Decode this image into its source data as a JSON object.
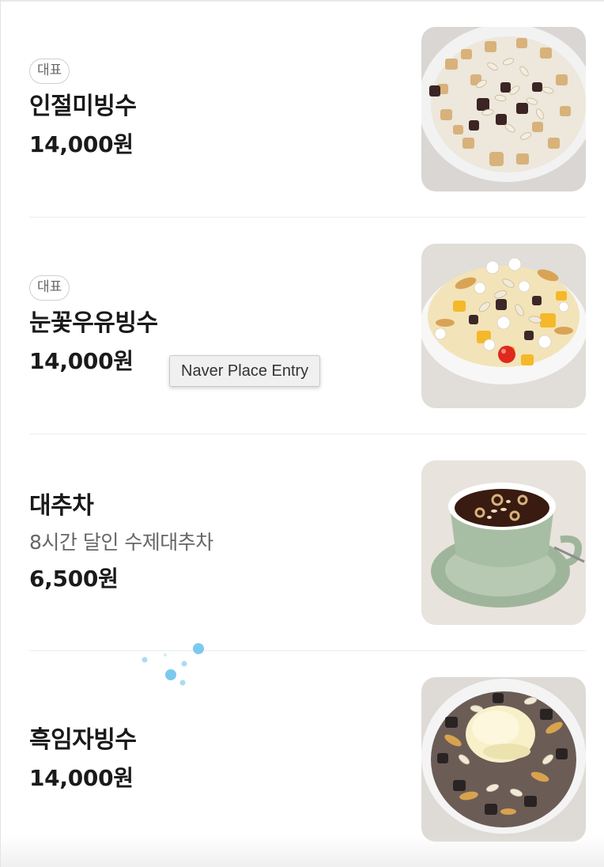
{
  "menu": {
    "items": [
      {
        "badge": "대표",
        "name": "인절미빙수",
        "price": "14,000원",
        "photo_icon": "injeolmi-bingsu-photo"
      },
      {
        "badge": "대표",
        "name": "눈꽃우유빙수",
        "price": "14,000원",
        "photo_icon": "milk-bingsu-photo"
      },
      {
        "name": "대추차",
        "description": "8시간 달인 수제대추차",
        "price": "6,500원",
        "photo_icon": "jujube-tea-photo"
      },
      {
        "name": "흑임자빙수",
        "price": "14,000원",
        "photo_icon": "black-sesame-bingsu-photo"
      }
    ]
  },
  "tooltip": {
    "text": "Naver Place Entry"
  },
  "colors": {
    "text_primary": "#1a1a1a",
    "text_secondary": "#666666",
    "divider": "#ececec",
    "loader_blue": "#7cc9ef"
  }
}
